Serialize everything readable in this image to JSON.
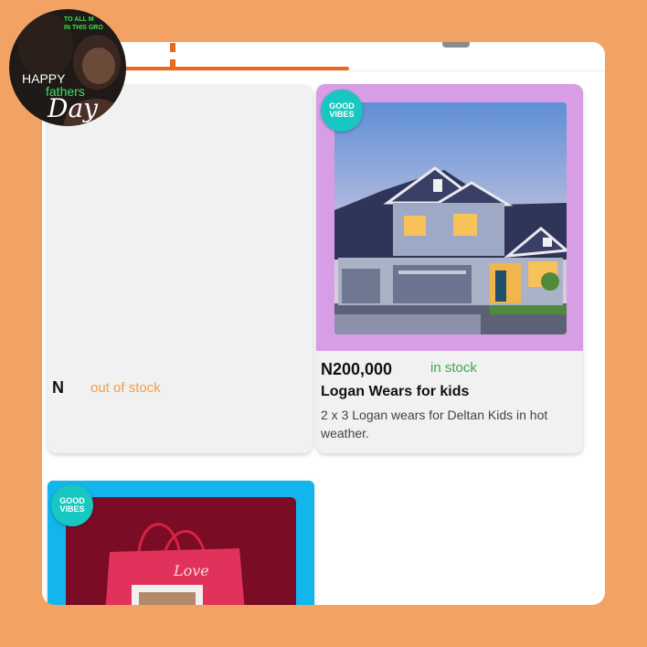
{
  "avatar": {
    "top_text_line1": "TO ALL M",
    "top_text_line2": "IN THIS GRO",
    "happy": "HAPPY",
    "fathers": "fathers",
    "day": "Day"
  },
  "tabs": {
    "active_icon": "home-icon",
    "inactive_icon": "chat-icon",
    "accent_color": "#e86a1e"
  },
  "products": [
    {
      "price": "N",
      "stock_status": "out of stock",
      "stock_color": "#f0a04b"
    },
    {
      "badge": "GOOD VIBES",
      "price": "N200,000",
      "stock_status": "in stock",
      "stock_color": "#3aa84a",
      "title": "Logan Wears for kids",
      "description": "2 x 3 Logan wears for Deltan Kids in hot weather.",
      "image": "house-photo"
    },
    {
      "badge": "GOOD VIBES",
      "gift_bag_text": "Love",
      "image": "gift-bag-photo"
    }
  ]
}
